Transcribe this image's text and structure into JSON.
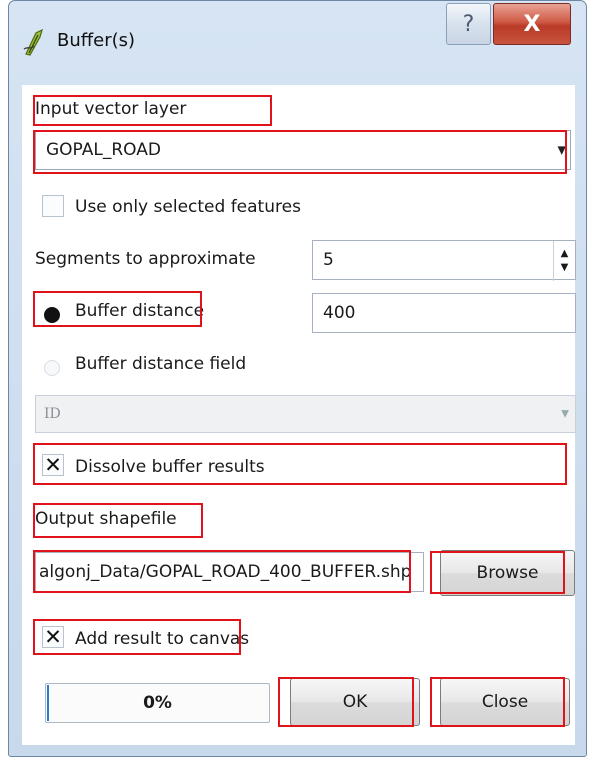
{
  "window": {
    "title": "Buffer(s)",
    "help_glyph": "?",
    "close_glyph": "X",
    "icon": "buffer-tool-icon"
  },
  "form": {
    "input_layer_label": "Input vector layer",
    "input_layer_value": "GOPAL_ROAD",
    "use_selected_label": "Use only selected features",
    "use_selected_checked": false,
    "segments_label": "Segments to approximate",
    "segments_value": "5",
    "buffer_distance_label": "Buffer distance",
    "buffer_distance_selected": true,
    "buffer_distance_value": "400",
    "buffer_field_label": "Buffer distance field",
    "buffer_field_selected": false,
    "buffer_field_value": "ID",
    "dissolve_label": "Dissolve buffer results",
    "dissolve_checked": true,
    "output_label": "Output shapefile",
    "output_value": "algonj_Data/GOPAL_ROAD_400_BUFFER.shp",
    "browse_label": "Browse",
    "add_canvas_label": "Add result to canvas",
    "add_canvas_checked": true
  },
  "footer": {
    "progress_text": "0%",
    "progress_value": 0,
    "ok_label": "OK",
    "close_label": "Close"
  },
  "colors": {
    "highlight": "#e0131b",
    "progress_fill": "#2a7ccf"
  }
}
